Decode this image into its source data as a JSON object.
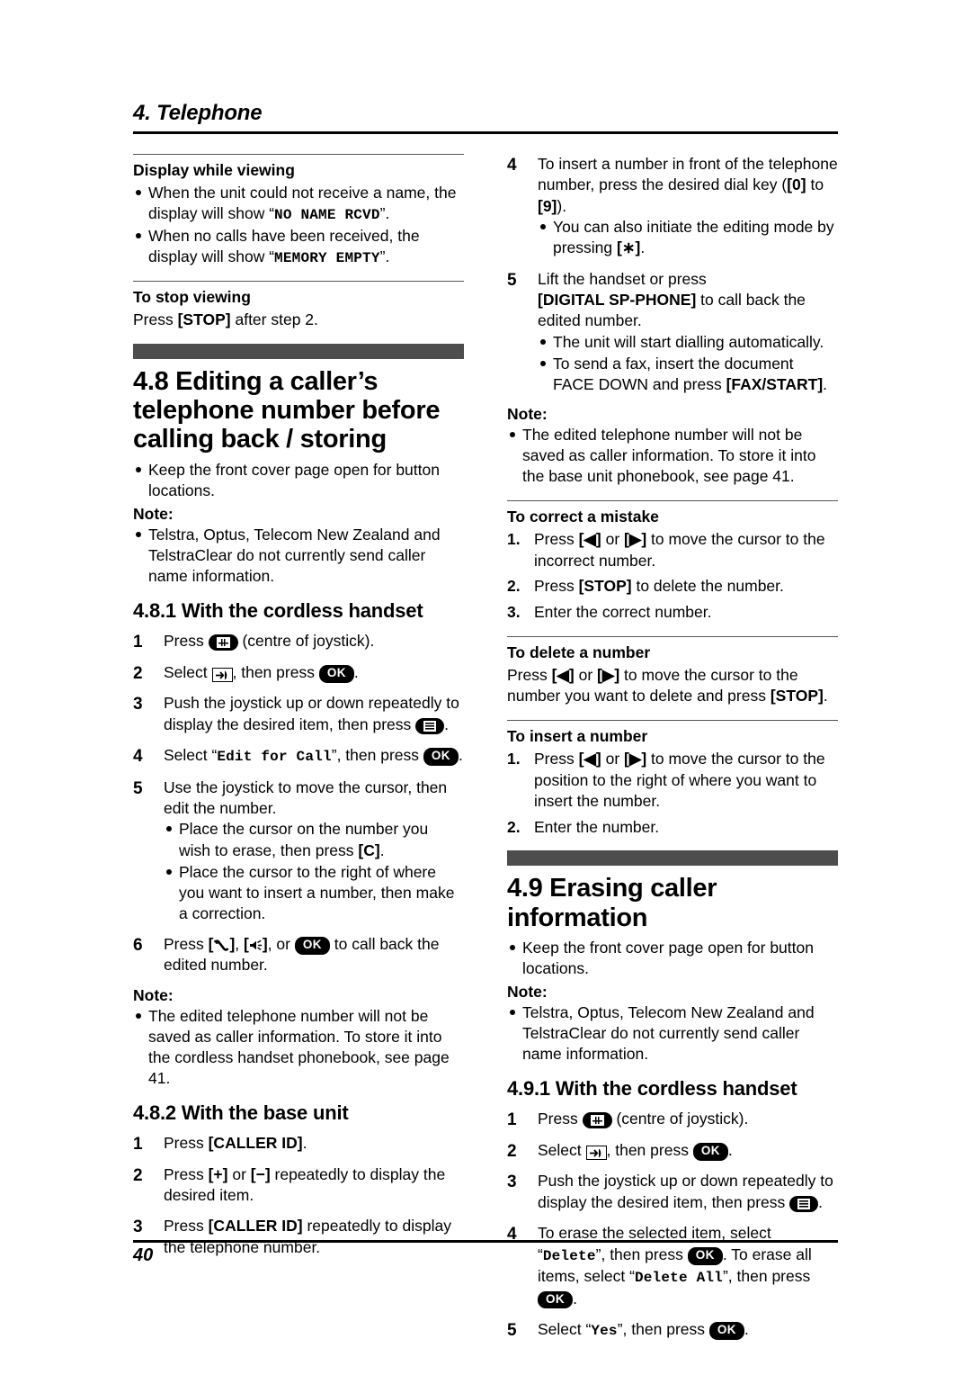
{
  "header": {
    "chapter": "4. Telephone"
  },
  "footer": {
    "page_number": "40"
  },
  "left_column": {
    "display_while_viewing": {
      "heading": "Display while viewing",
      "bullets": [
        {
          "pre": "When the unit could not receive a name, the display will show “",
          "mono": "NO NAME RCVD",
          "post": "”."
        },
        {
          "pre": "When no calls have been received, the display will show “",
          "mono": "MEMORY EMPTY",
          "post": "”."
        }
      ]
    },
    "to_stop_viewing": {
      "heading": "To stop viewing",
      "pre": "Press ",
      "key": "[STOP]",
      "post": " after step 2."
    },
    "section_48": {
      "title": "4.8 Editing a caller’s telephone number before calling back / storing",
      "bullet": "Keep the front cover page open for button locations.",
      "note_label": "Note:",
      "note_bullet": "Telstra, Optus, Telecom New Zealand and TelstraClear do not currently send caller name information."
    },
    "section_481": {
      "title": "4.8.1 With the cordless handset",
      "steps": [
        {
          "num": "1",
          "text_pre": "Press ",
          "icon": "joystick-centre-icon",
          "text_post": " (centre of joystick)."
        },
        {
          "num": "2",
          "text_pre": "Select ",
          "icon": "caller-list-icon",
          "text_mid": ", then press ",
          "icon2": "ok-button-icon",
          "text_post": "."
        },
        {
          "num": "3",
          "text_pre": "Push the joystick up or down repeatedly to display the desired item, then press ",
          "icon": "menu-button-icon",
          "text_post": "."
        },
        {
          "num": "4",
          "text_pre": "Select “",
          "mono": "Edit for Call",
          "text_mid": "”, then press ",
          "icon2": "ok-button-icon",
          "text_post": "."
        },
        {
          "num": "5",
          "text_pre": "Use the joystick to move the cursor, then edit the number."
        },
        {
          "num": "6",
          "text_pre": "Press ",
          "icon": "talk-handset-icon",
          "text_mid": ", ",
          "icon2": "speakerphone-icon",
          "text_mid2": ", or ",
          "icon3": "ok-button-icon",
          "text_post": " to call back the edited number."
        }
      ],
      "step5_subbullets": [
        {
          "pre": "Place the cursor on the number you wish to erase, then press ",
          "key": "[C]",
          "post": "."
        },
        {
          "pre": "Place the cursor to the right of where you want to insert a number, then make a correction.",
          "key": "",
          "post": ""
        }
      ],
      "note_label": "Note:",
      "note_bullet": "The edited telephone number will not be saved as caller information. To store it into the cordless handset phonebook, see page 41."
    },
    "section_482": {
      "title": "4.8.2 With the base unit",
      "steps": [
        {
          "num": "1",
          "text_pre": "Press ",
          "key": "[CALLER ID]",
          "text_post": "."
        },
        {
          "num": "2",
          "text_pre": "Press ",
          "key": "[+]",
          "text_mid": " or ",
          "key2": "[−]",
          "text_post": " repeatedly to display the desired item."
        },
        {
          "num": "3",
          "text_pre": "Press ",
          "key": "[CALLER ID]",
          "text_post": " repeatedly to display the telephone number."
        }
      ]
    }
  },
  "right_column": {
    "continued_steps": [
      {
        "num": "4",
        "text_pre": "To insert a number in front of the telephone number, press the desired dial key (",
        "key": "[0]",
        "text_mid": " to ",
        "key2": "[9]",
        "text_post": ").",
        "subbullets": [
          {
            "pre": "You can also initiate the editing mode by pressing ",
            "key": "[∗]",
            "post": "."
          }
        ]
      },
      {
        "num": "5",
        "text_pre": "Lift the handset or press ",
        "key": "[DIGITAL SP-PHONE]",
        "text_post": " to call back the edited number.",
        "subbullets": [
          {
            "pre": "The unit will start dialling automatically.",
            "key": "",
            "post": ""
          },
          {
            "pre": "To send a fax, insert the document FACE DOWN and press ",
            "key": "[FAX/START]",
            "post": "."
          }
        ]
      }
    ],
    "note": {
      "label": "Note:",
      "bullet": "The edited telephone number will not be saved as caller information. To store it into the base unit phonebook, see page 41."
    },
    "to_correct_a_mistake": {
      "heading": "To correct a mistake",
      "steps": [
        {
          "num": "1.",
          "pre": "Press ",
          "icon": "arrow-left-key-icon",
          "mid": " or ",
          "icon2": "arrow-right-key-icon",
          "post": " to move the cursor to the incorrect number."
        },
        {
          "num": "2.",
          "pre": "Press ",
          "key": "[STOP]",
          "post": " to delete the number."
        },
        {
          "num": "3.",
          "pre": "Enter the correct number.",
          "post": ""
        }
      ]
    },
    "to_delete_a_number": {
      "heading": "To delete a number",
      "pre": "Press ",
      "icon": "arrow-left-key-icon",
      "mid": " or ",
      "icon2": "arrow-right-key-icon",
      "mid2": " to move the cursor to the number you want to delete and press ",
      "key": "[STOP]",
      "post": "."
    },
    "to_insert_a_number": {
      "heading": "To insert a number",
      "steps": [
        {
          "num": "1.",
          "pre": "Press ",
          "icon": "arrow-left-key-icon",
          "mid": " or ",
          "icon2": "arrow-right-key-icon",
          "post": " to move the cursor to the position to the right of where you want to insert the number."
        },
        {
          "num": "2.",
          "pre": "Enter the number.",
          "post": ""
        }
      ]
    },
    "section_49": {
      "title": "4.9 Erasing caller information",
      "bullet": "Keep the front cover page open for button locations.",
      "note_label": "Note:",
      "note_bullet": "Telstra, Optus, Telecom New Zealand and TelstraClear do not currently send caller name information."
    },
    "section_491": {
      "title": "4.9.1 With the cordless handset",
      "steps": [
        {
          "num": "1",
          "text_pre": "Press ",
          "icon": "joystick-centre-icon",
          "text_post": " (centre of joystick)."
        },
        {
          "num": "2",
          "text_pre": "Select ",
          "icon": "caller-list-icon",
          "text_mid": ", then press ",
          "icon2": "ok-button-icon",
          "text_post": "."
        },
        {
          "num": "3",
          "text_pre": "Push the joystick up or down repeatedly to display the desired item, then press ",
          "icon": "menu-button-icon",
          "text_post": "."
        },
        {
          "num": "4",
          "text_pre": "To erase the selected item, select “",
          "mono": "Delete",
          "text_mid": "”, then press ",
          "icon2": "ok-button-icon",
          "text_mid2": ". To erase all items, select “",
          "mono2": "Delete All",
          "text_mid3": "”, then press ",
          "icon3": "ok-button-icon",
          "text_post": "."
        },
        {
          "num": "5",
          "text_pre": "Select “",
          "mono": "Yes",
          "text_mid": "”, then press ",
          "icon2": "ok-button-icon",
          "text_post": "."
        }
      ]
    }
  },
  "icons": {
    "ok_label": "OK"
  },
  "colors": {
    "graybar": "#4d4d4d",
    "rule": "#000000"
  }
}
